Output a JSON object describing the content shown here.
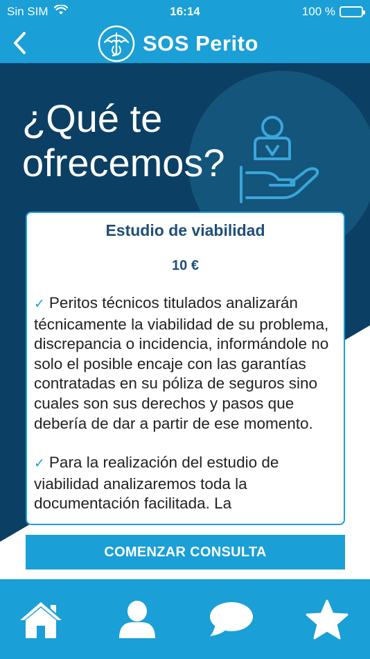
{
  "status_bar": {
    "carrier": "Sin SIM",
    "time": "16:14",
    "battery": "100 %"
  },
  "nav": {
    "back_icon": "chevron-left-icon",
    "brand_name": "SOS Perito"
  },
  "hero": {
    "title": "¿Qué te ofrecemos?"
  },
  "service": {
    "title": "Estudio de viabilidad",
    "price": "10 €",
    "bullets": [
      "Peritos técnicos titulados analizarán técnicamente la viabilidad de su problema, discrepancia o incidencia, informándole no solo el posible encaje con las garantías contratadas en su póliza de seguros sino cuales son sus derechos y pasos que debería de dar a partir de ese momento.",
      "Para la realización del estudio de viabilidad analizaremos toda la documentación facilitada. La"
    ]
  },
  "cta": {
    "label": "COMENZAR CONSULTA"
  },
  "tabs": [
    {
      "icon": "home-icon"
    },
    {
      "icon": "user-icon"
    },
    {
      "icon": "chat-icon"
    },
    {
      "icon": "star-icon"
    }
  ],
  "colors": {
    "accent": "#1a9fd6",
    "navy": "#0b3f63",
    "text": "#1f4e79"
  }
}
